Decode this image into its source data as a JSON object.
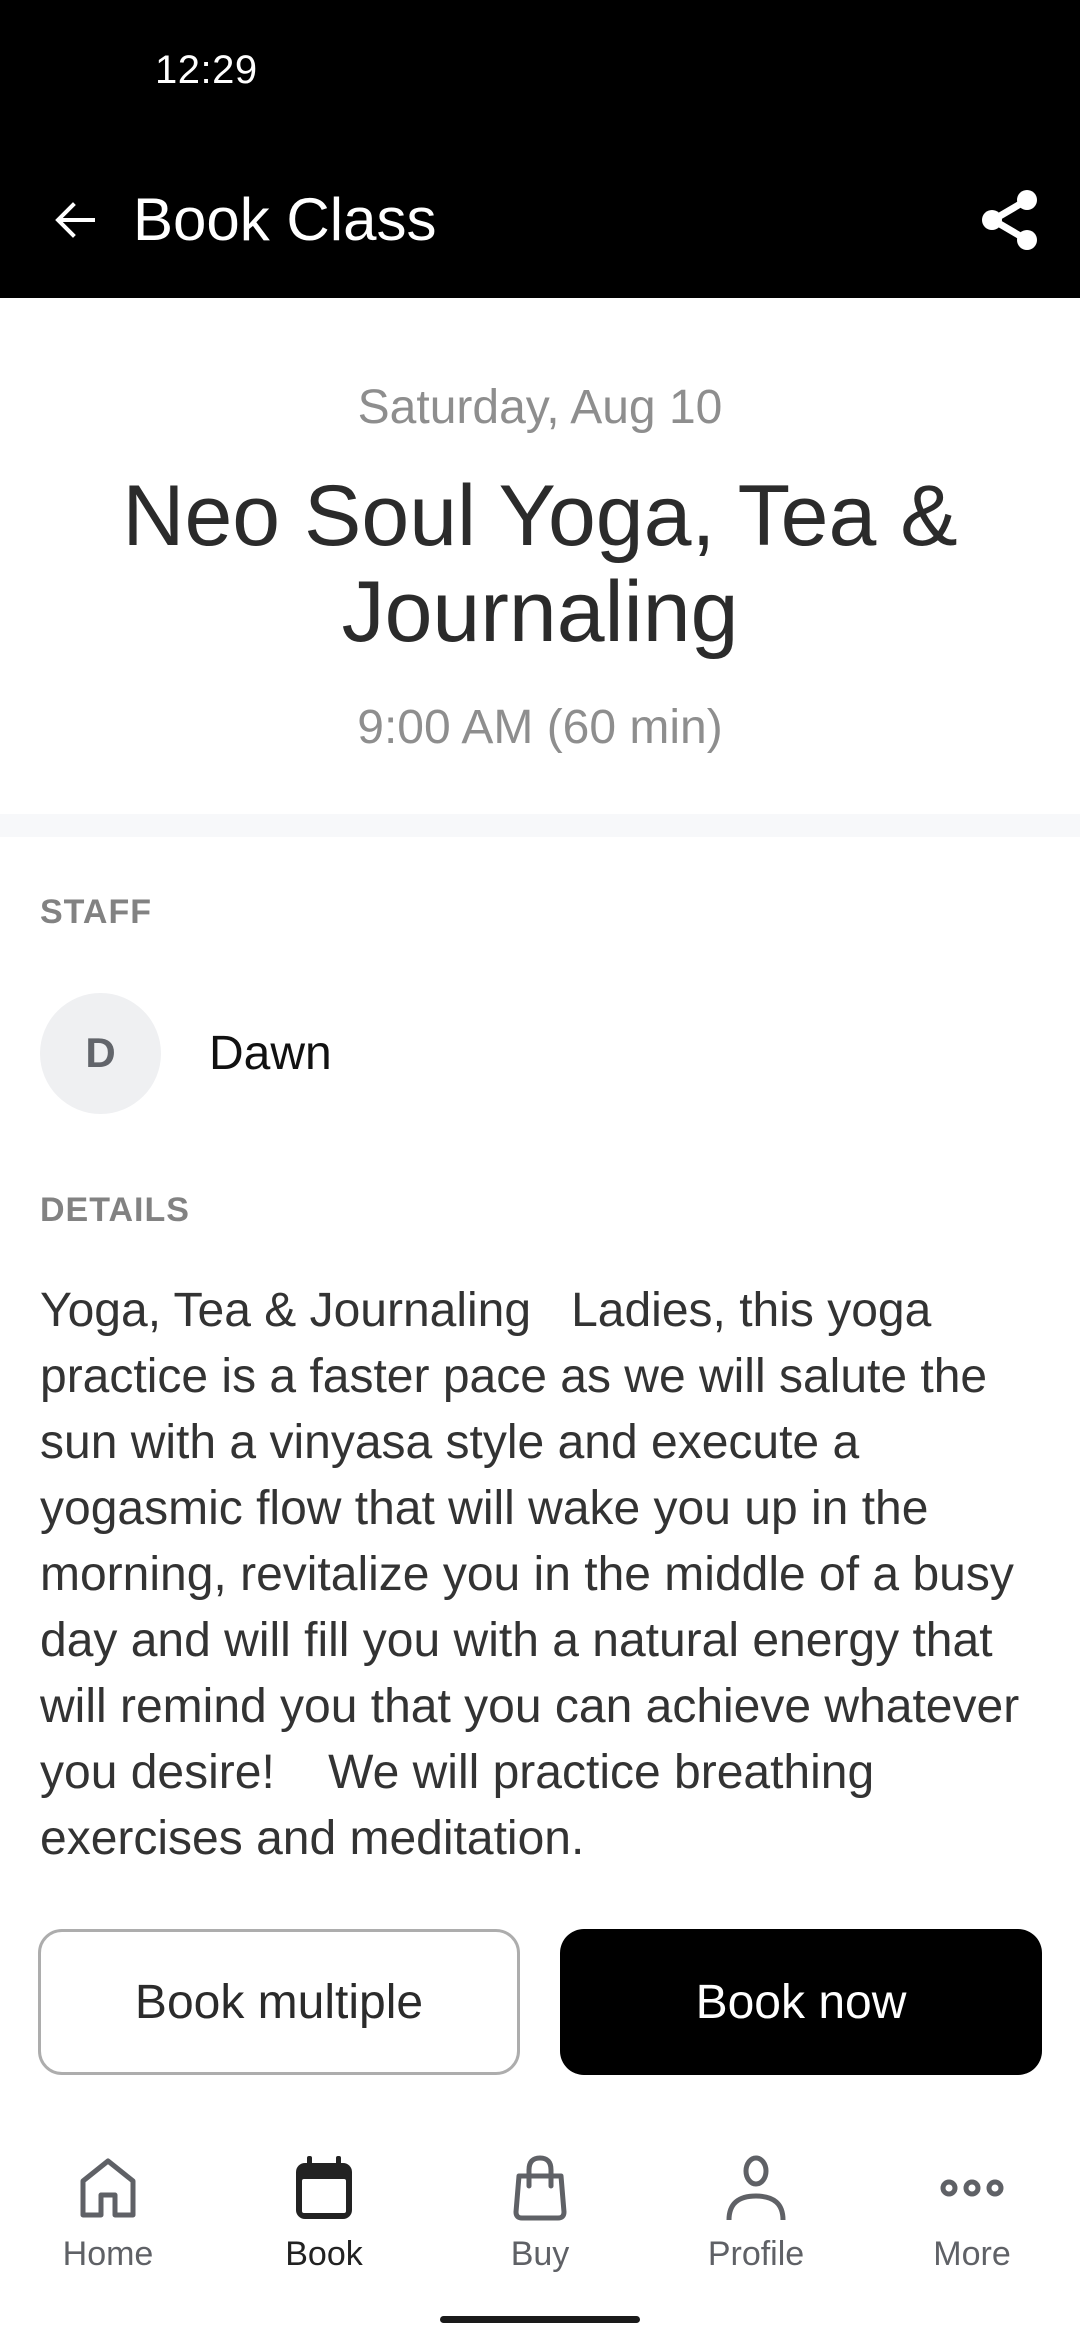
{
  "status_bar": {
    "time": "12:29"
  },
  "app_bar": {
    "title": "Book Class",
    "back_icon": "arrow-left-icon",
    "share_icon": "share-icon"
  },
  "class": {
    "date": "Saturday, Aug 10",
    "title": "Neo Soul Yoga, Tea & Journaling",
    "time": "9:00 AM (60 min)"
  },
  "staff": {
    "section_label": "STAFF",
    "avatar_initial": "D",
    "name": "Dawn"
  },
  "details": {
    "section_label": "DETAILS",
    "text": "Yoga, Tea & Journaling   Ladies, this yoga practice is a faster pace as we will salute the sun with a vinyasa style and execute a yogasmic flow that will wake you up in the morning, revitalize you in the middle of a busy day and will fill you with a natural energy that will remind you that you can achieve whatever you desire!    We will practice breathing exercises and meditation."
  },
  "actions": {
    "book_multiple": "Book multiple",
    "book_now": "Book now"
  },
  "nav": {
    "active": "Book",
    "items": [
      {
        "label": "Home",
        "icon": "home-icon"
      },
      {
        "label": "Book",
        "icon": "calendar-icon"
      },
      {
        "label": "Buy",
        "icon": "shopping-bag-icon"
      },
      {
        "label": "Profile",
        "icon": "person-icon"
      },
      {
        "label": "More",
        "icon": "more-dots-icon"
      }
    ]
  },
  "colors": {
    "header_bg": "#000000",
    "primary_button": "#000000",
    "muted_text": "#8e8e8e",
    "section_label": "#828282",
    "band": "#f7f8fa",
    "avatar_bg": "#eff0f2"
  }
}
